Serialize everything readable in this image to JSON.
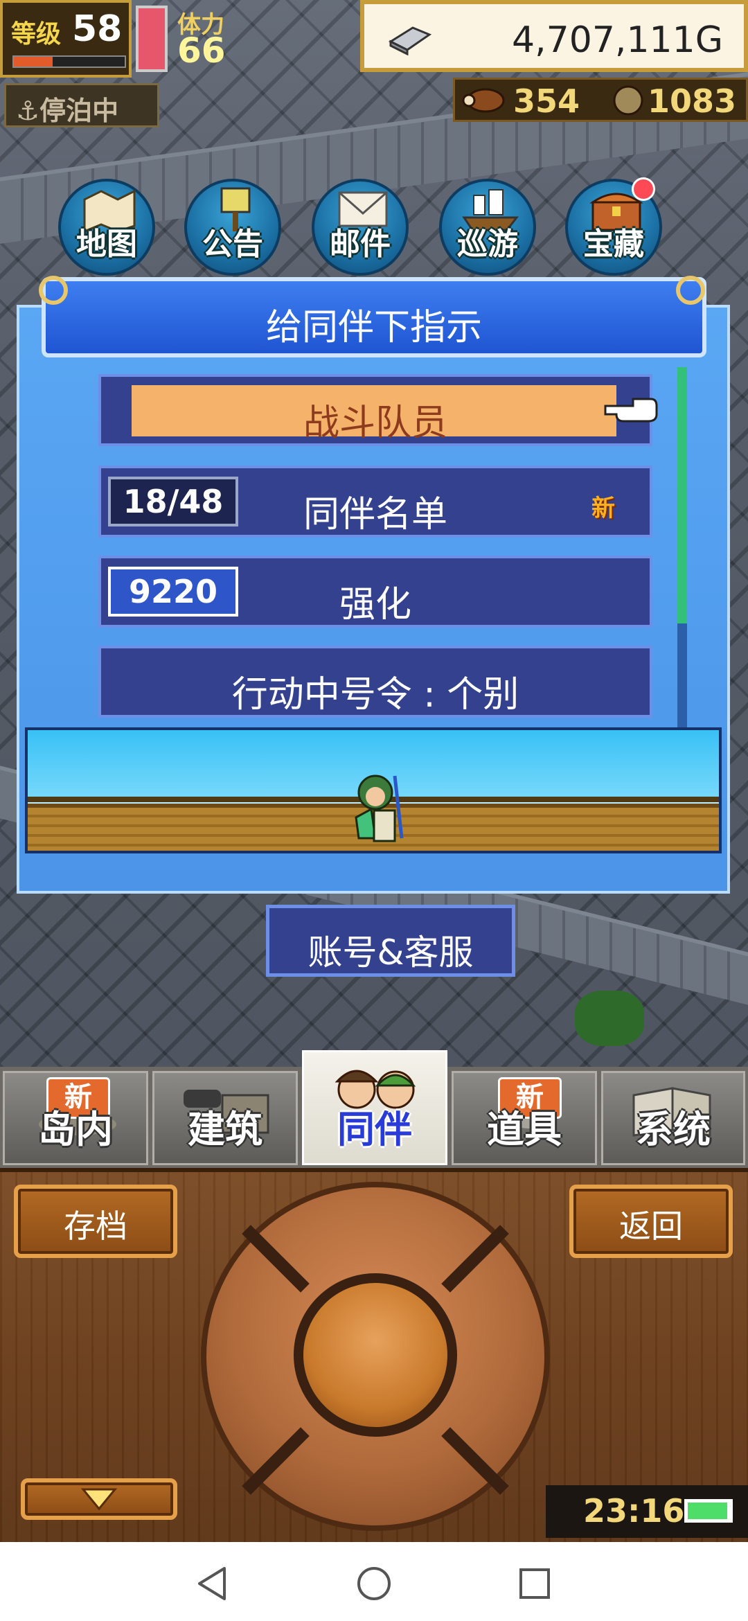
{
  "hud": {
    "level_label": "等级",
    "level": "58",
    "exp_fraction": 0.35,
    "stamina_label": "体力",
    "stamina": "66",
    "money": "4,707,111G",
    "anchor_label": "停泊中",
    "resource_a": "354",
    "resource_b": "1083"
  },
  "top_menu": {
    "items": [
      {
        "label": "地图",
        "icon": "map-icon"
      },
      {
        "label": "公告",
        "icon": "notice-board-icon"
      },
      {
        "label": "邮件",
        "icon": "mail-icon"
      },
      {
        "label": "巡游",
        "icon": "ship-icon"
      },
      {
        "label": "宝藏",
        "icon": "treasure-chest-icon"
      }
    ]
  },
  "dialog": {
    "title": "给同伴下指示",
    "items": [
      {
        "label": "战斗队员"
      },
      {
        "label": "同伴名单",
        "count": "18/48",
        "badge": "新"
      },
      {
        "label": "强化",
        "count": "9220"
      },
      {
        "label": "行动中号令 : 个别"
      }
    ]
  },
  "account_button": "账号&客服",
  "tabs": [
    {
      "label": "岛内",
      "badge": "新",
      "icon": "island-icon"
    },
    {
      "label": "建筑",
      "icon": "building-icon"
    },
    {
      "label": "同伴",
      "icon": "companions-icon",
      "active": true
    },
    {
      "label": "道具",
      "badge": "新",
      "icon": "items-icon"
    },
    {
      "label": "系统",
      "icon": "system-book-icon"
    }
  ],
  "controls": {
    "save_label": "存档",
    "back_label": "返回"
  },
  "status": {
    "time": "23:16",
    "battery_level": 0.95
  },
  "colors": {
    "dialog_blue": "#4b94e8",
    "menu_item_navy": "#33418f",
    "highlight_orange": "#f4b26b",
    "active_tab_text": "#2a3cd8",
    "money_panel": "#fbf4e3"
  }
}
